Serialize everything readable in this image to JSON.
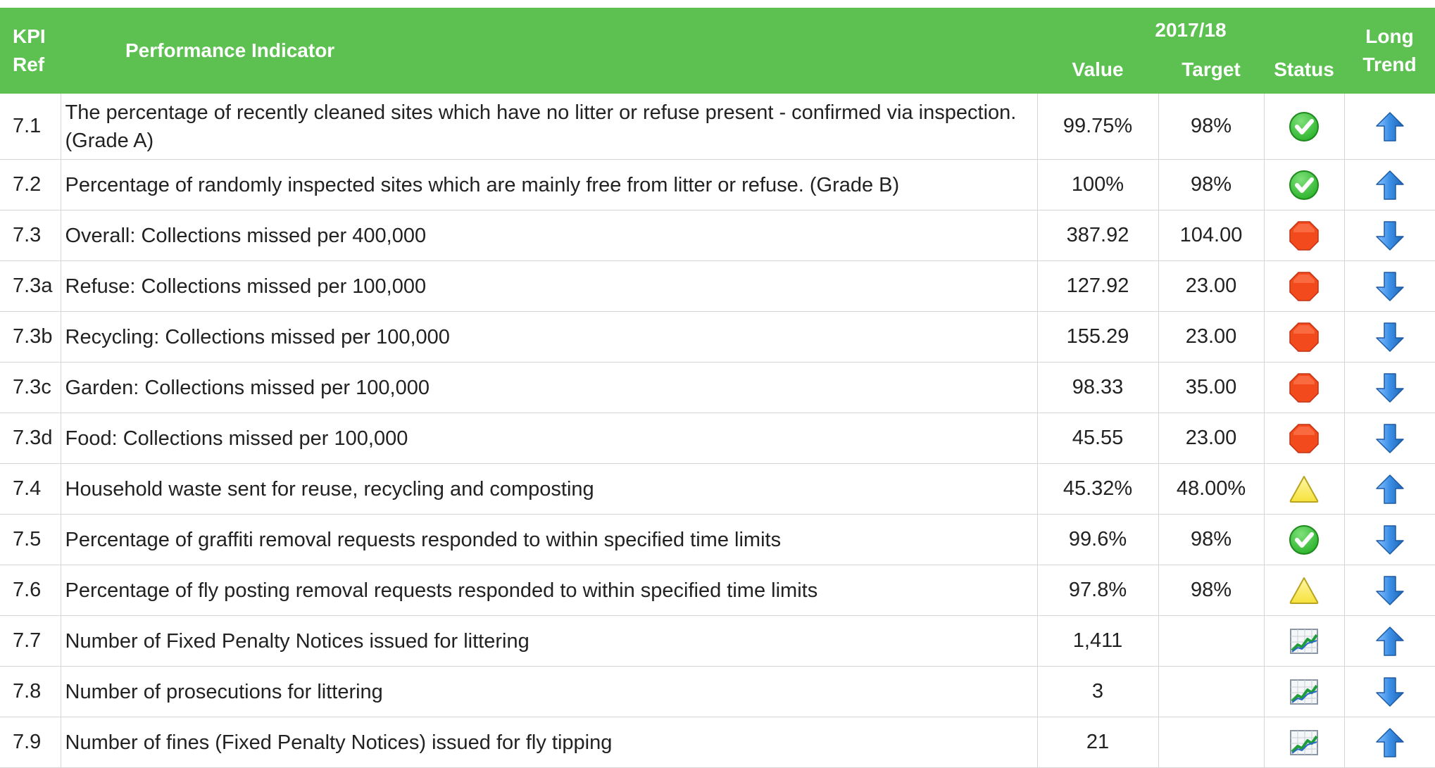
{
  "header": {
    "kpi_ref": "KPI Ref",
    "indicator": "Performance Indicator",
    "year": "2017/18",
    "value": "Value",
    "target": "Target",
    "status": "Status",
    "trend": "Long Trend"
  },
  "rows": [
    {
      "ref": "7.1",
      "indicator": "The percentage of recently cleaned sites which have no litter or refuse present - confirmed via inspection. (Grade A)",
      "value": "99.75%",
      "target": "98%",
      "status": "check-icon",
      "trend": "up"
    },
    {
      "ref": "7.2",
      "indicator": "Percentage of randomly inspected sites which are mainly free from litter or refuse.  (Grade B)",
      "value": "100%",
      "target": "98%",
      "status": "check-icon",
      "trend": "up"
    },
    {
      "ref": "7.3",
      "indicator": "Overall: Collections missed per 400,000",
      "value": "387.92",
      "target": "104.00",
      "status": "stop-icon",
      "trend": "down"
    },
    {
      "ref": "7.3a",
      "indicator": "Refuse: Collections missed per 100,000",
      "value": "127.92",
      "target": "23.00",
      "status": "stop-icon",
      "trend": "down"
    },
    {
      "ref": "7.3b",
      "indicator": "Recycling: Collections missed per 100,000",
      "value": "155.29",
      "target": "23.00",
      "status": "stop-icon",
      "trend": "down"
    },
    {
      "ref": "7.3c",
      "indicator": "Garden: Collections missed per 100,000",
      "value": "98.33",
      "target": "35.00",
      "status": "stop-icon",
      "trend": "down"
    },
    {
      "ref": "7.3d",
      "indicator": "Food: Collections missed per 100,000",
      "value": "45.55",
      "target": "23.00",
      "status": "stop-icon",
      "trend": "down"
    },
    {
      "ref": "7.4",
      "indicator": "Household waste sent for reuse, recycling and composting",
      "value": "45.32%",
      "target": "48.00%",
      "status": "warning-icon",
      "trend": "up"
    },
    {
      "ref": "7.5",
      "indicator": "Percentage of graffiti removal requests responded to within specified time limits",
      "value": "99.6%",
      "target": "98%",
      "status": "check-icon",
      "trend": "down"
    },
    {
      "ref": "7.6",
      "indicator": "Percentage of fly posting removal requests responded to within specified time limits",
      "value": "97.8%",
      "target": "98%",
      "status": "warning-icon",
      "trend": "down"
    },
    {
      "ref": "7.7",
      "indicator": "Number of Fixed Penalty Notices issued for littering",
      "value": "1,411",
      "target": "",
      "status": "chart-icon",
      "trend": "up"
    },
    {
      "ref": "7.8",
      "indicator": "Number of prosecutions for littering",
      "value": "3",
      "target": "",
      "status": "chart-icon",
      "trend": "down"
    },
    {
      "ref": "7.9",
      "indicator": "Number of fines (Fixed Penalty Notices) issued for fly tipping",
      "value": "21",
      "target": "",
      "status": "chart-icon",
      "trend": "up"
    }
  ],
  "colors": {
    "header_bg": "#5dc151",
    "check": "#2fb52f",
    "stop": "#f24a1d",
    "warning": "#f5e23a",
    "arrow": "#3a8ee6"
  }
}
